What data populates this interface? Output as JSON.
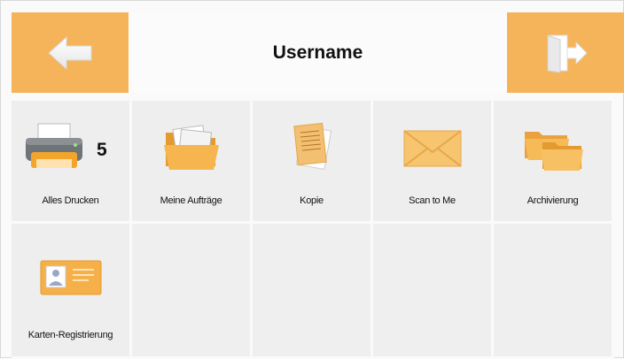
{
  "header": {
    "title": "Username",
    "back_icon": "arrow-left-icon",
    "logout_icon": "exit-door-icon",
    "accent": "#f5b45a"
  },
  "tiles": [
    {
      "label": "Alles Drucken",
      "icon": "printer-icon",
      "count": "5"
    },
    {
      "label": "Meine Aufträge",
      "icon": "folder-documents-icon"
    },
    {
      "label": "Kopie",
      "icon": "copy-documents-icon"
    },
    {
      "label": "Scan to Me",
      "icon": "envelope-icon"
    },
    {
      "label": "Archivierung",
      "icon": "folders-icon"
    },
    {
      "label": "Karten-Registrierung",
      "icon": "id-card-icon"
    }
  ]
}
